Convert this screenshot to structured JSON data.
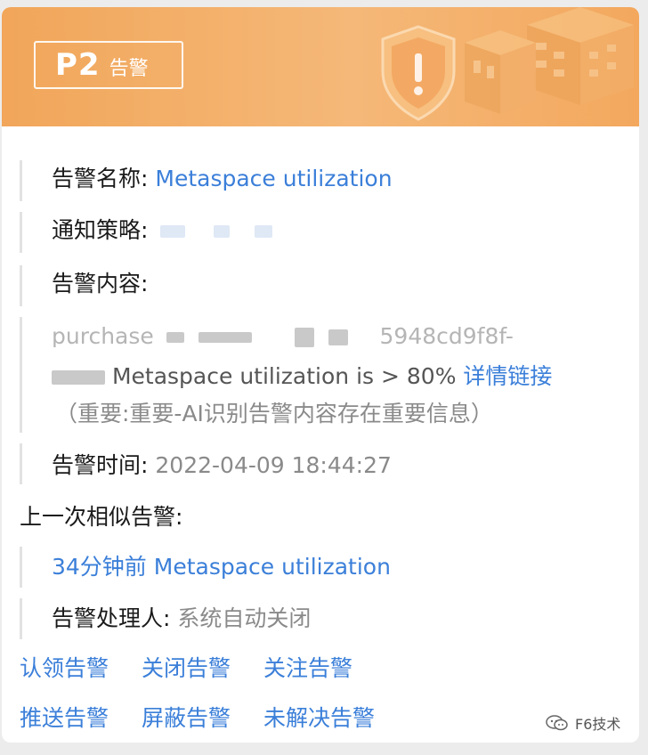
{
  "header": {
    "level": "P2",
    "title": "告警",
    "accent_color": "#f1a65a"
  },
  "alert": {
    "name_label": "告警名称:",
    "name_value": "Metaspace utilization",
    "policy_label": "通知策略:",
    "content_label": "告警内容:",
    "content_line1_start": "purchase",
    "content_line1_end": "5948cd9f8f-",
    "content_line2_start": "",
    "content_line2_text": "Metaspace utilization is > 80%",
    "detail_link": "详情链接",
    "importance_note": "（重要:重要-AI识别告警内容存在重要信息）",
    "time_label": "告警时间:",
    "time_value": "2022-04-09 18:44:27",
    "previous_label": "上一次相似告警:",
    "previous_value": "34分钟前 Metaspace utilization",
    "handler_label": "告警处理人:",
    "handler_value": "系统自动关闭"
  },
  "actions": {
    "claim": "认领告警",
    "close": "关闭告警",
    "follow": "关注告警",
    "push": "推送告警",
    "mask": "屏蔽告警",
    "unresolved": "未解决告警"
  },
  "watermark": {
    "text": "F6技术",
    "icon": "wechat-icon"
  },
  "colors": {
    "link": "#3b7fd9",
    "muted": "#8a8a8a"
  }
}
